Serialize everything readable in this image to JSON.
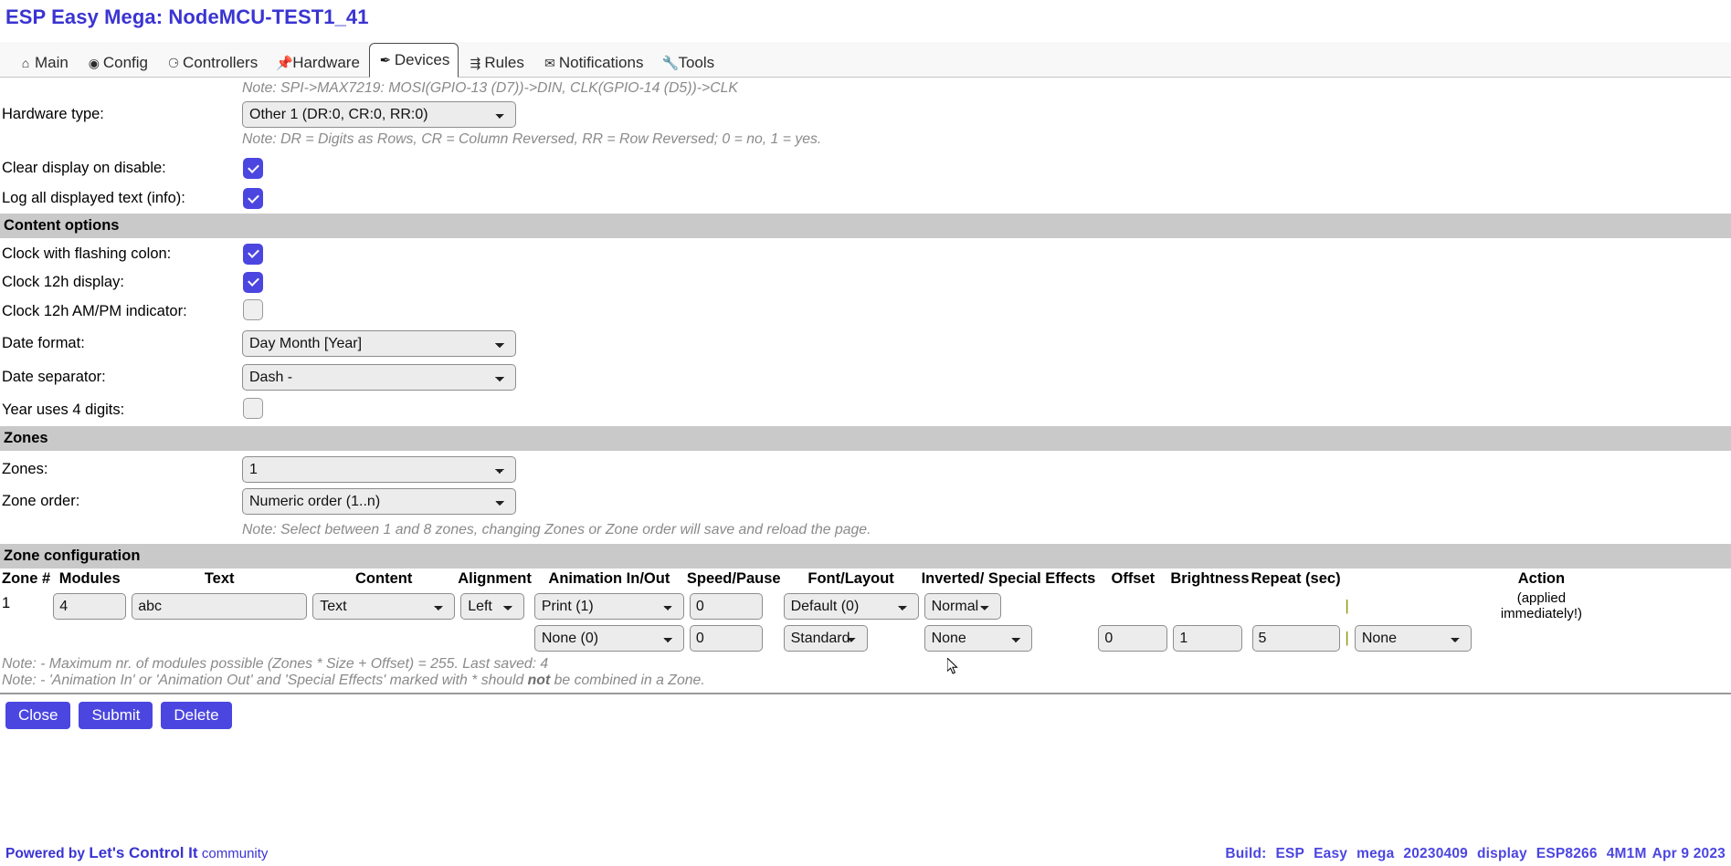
{
  "header": {
    "title": "ESP Easy Mega: NodeMCU-TEST1_41"
  },
  "tabs": [
    {
      "label": "Main",
      "icon": "home-icon",
      "glyph": "⌂",
      "active": false
    },
    {
      "label": "Config",
      "icon": "gear-icon",
      "glyph": "⚙",
      "active": false
    },
    {
      "label": "Controllers",
      "icon": "chat-icon",
      "glyph": "▣",
      "active": false
    },
    {
      "label": "Hardware",
      "icon": "pin-icon",
      "glyph": "📌",
      "active": false
    },
    {
      "label": "Devices",
      "icon": "plug-icon",
      "glyph": "✒",
      "active": true
    },
    {
      "label": "Rules",
      "icon": "branch-icon",
      "glyph": "⇶",
      "active": false
    },
    {
      "label": "Notifications",
      "icon": "envelope-icon",
      "glyph": "✉",
      "active": false
    },
    {
      "label": "Tools",
      "icon": "wrench-icon",
      "glyph": "🔧",
      "active": false
    }
  ],
  "hardware": {
    "note_spi": "Note: SPI->MAX7219: MOSI(GPIO-13 (D7))->DIN, CLK(GPIO-14 (D5))->CLK",
    "type_label": "Hardware type:",
    "type_value": "Other 1 (DR:0, CR:0, RR:0)",
    "note_dr": "Note: DR = Digits as Rows, CR = Column Reversed, RR = Row Reversed; 0 = no, 1 = yes.",
    "clear_label": "Clear display on disable:",
    "clear_checked": true,
    "log_label": "Log all displayed text (info):",
    "log_checked": true
  },
  "content_options": {
    "section": "Content options",
    "flashing_colon_label": "Clock with flashing colon:",
    "flashing_colon_checked": true,
    "clock12h_label": "Clock 12h display:",
    "clock12h_checked": true,
    "ampm_label": "Clock 12h AM/PM indicator:",
    "ampm_checked": false,
    "date_format_label": "Date format:",
    "date_format_value": "Day Month [Year]",
    "date_separator_label": "Date separator:",
    "date_separator_value": "Dash -",
    "year4_label": "Year uses 4 digits:",
    "year4_checked": false
  },
  "zones": {
    "section": "Zones",
    "zones_label": "Zones:",
    "zones_value": "1",
    "zone_order_label": "Zone order:",
    "zone_order_value": "Numeric order (1..n)",
    "note": "Note: Select between 1 and 8 zones, changing Zones or Zone order will save and reload the page."
  },
  "zone_config": {
    "section": "Zone configuration",
    "headers": [
      "Zone #",
      "Modules",
      "Text",
      "Content",
      "Alignment",
      "Animation In/Out",
      "Speed/Pause",
      "Font/Layout",
      "Inverted/ Special Effects",
      "Offset",
      "Brightness",
      "Repeat (sec)",
      "Action"
    ],
    "action_note_line1": "(applied",
    "action_note_line2": "immediately!)",
    "rows": [
      {
        "zone": "1",
        "modules": "4",
        "text": "abc",
        "content": "Text",
        "alignment": "Left",
        "animation_in": "Print (1)",
        "animation_out": "None (0)",
        "speed": "0",
        "pause": "0",
        "font": "Default (0)",
        "layout": "Standard",
        "inverted": "Normal",
        "special_effects": "None",
        "offset": "0",
        "brightness": "1",
        "repeat": "5",
        "action": "None"
      }
    ]
  },
  "notes": {
    "max_modules": "Note: - Maximum nr. of modules possible (Zones * Size + Offset) = 255. Last saved: 4",
    "animation_pre": "Note: - 'Animation In' or 'Animation Out' and 'Special Effects' marked with * should ",
    "animation_bold": "not",
    "animation_post": " be combined in a Zone."
  },
  "buttons": {
    "close": "Close",
    "submit": "Submit",
    "delete": "Delete"
  },
  "footer": {
    "powered_prefix": "Powered by",
    "brand": "Let's Control It",
    "community": "community",
    "build_label": "Build:",
    "build_parts": [
      "ESP",
      "Easy",
      "mega",
      "20230409",
      "display",
      "ESP8266",
      "4M1M",
      "Apr 9 2023"
    ]
  },
  "colors": {
    "accent": "#4b46e0",
    "section_bar": "#c9c9c9",
    "note_text": "#8a8a8a"
  }
}
